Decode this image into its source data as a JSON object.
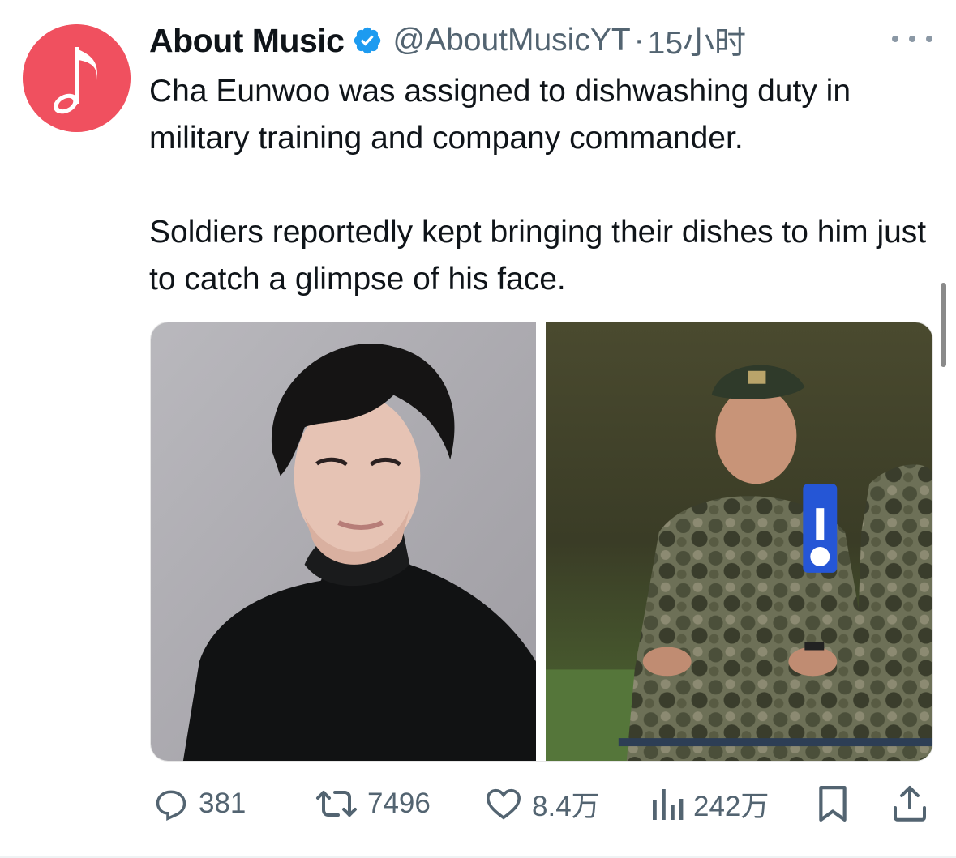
{
  "tweet": {
    "author_name": "About Music",
    "handle": "@AboutMusicYT",
    "separator": "·",
    "time": "15小时",
    "paragraphs": [
      "Cha Eunwoo was assigned to dishwashing duty in military training and company commander.",
      "Soldiers reportedly kept bringing their dishes to him just to catch a glimpse of his face."
    ]
  },
  "stats": {
    "replies": "381",
    "reposts": "7496",
    "likes": "8.4万",
    "views": "242万"
  },
  "icons": {
    "avatar": "music-note-icon",
    "verified": "verified-badge-icon",
    "more": "more-options-icon",
    "reply": "reply-icon",
    "repost": "repost-icon",
    "like": "heart-icon",
    "views": "views-chart-icon",
    "bookmark": "bookmark-icon",
    "share": "share-icon"
  },
  "colors": {
    "avatar_bg": "#f0505f",
    "verified": "#1d9bf0",
    "secondary_text": "#536471",
    "primary_text": "#0f1419"
  }
}
